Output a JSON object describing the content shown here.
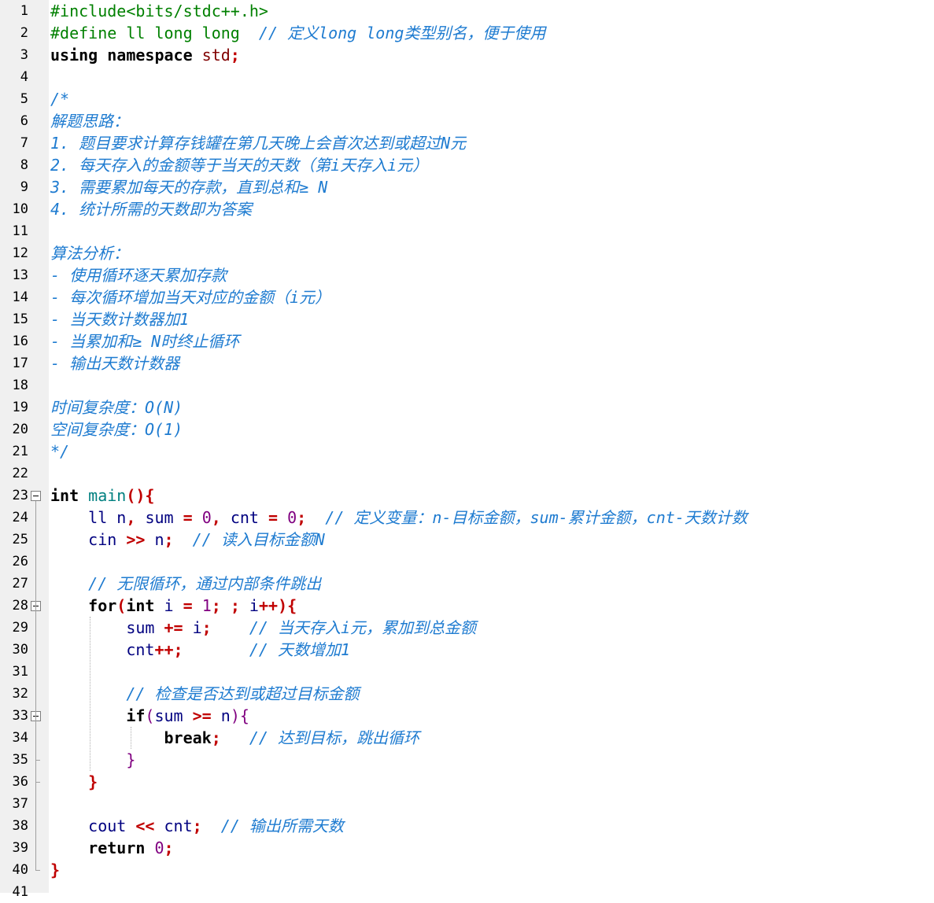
{
  "editor": {
    "lines": [
      [
        {
          "c": "pp",
          "t": "#include<bits/stdc++.h>"
        }
      ],
      [
        {
          "c": "pp",
          "t": "#define ll long long  "
        },
        {
          "c": "cm",
          "t": "// 定义long long类型别名，便于使用"
        }
      ],
      [
        {
          "c": "ns",
          "t": "using namespace "
        },
        {
          "c": "std",
          "t": "std"
        },
        {
          "c": "op",
          "t": ";"
        }
      ],
      [],
      [
        {
          "c": "cm",
          "t": "/*"
        }
      ],
      [
        {
          "c": "cm",
          "t": "解题思路："
        }
      ],
      [
        {
          "c": "cm",
          "t": "1. 题目要求计算存钱罐在第几天晚上会首次达到或超过N元"
        }
      ],
      [
        {
          "c": "cm",
          "t": "2. 每天存入的金额等于当天的天数（第i天存入i元）"
        }
      ],
      [
        {
          "c": "cm",
          "t": "3. 需要累加每天的存款，直到总和≥ N"
        }
      ],
      [
        {
          "c": "cm",
          "t": "4. 统计所需的天数即为答案"
        }
      ],
      [],
      [
        {
          "c": "cm",
          "t": "算法分析："
        }
      ],
      [
        {
          "c": "cm",
          "t": "- 使用循环逐天累加存款"
        }
      ],
      [
        {
          "c": "cm",
          "t": "- 每次循环增加当天对应的金额（i元）"
        }
      ],
      [
        {
          "c": "cm",
          "t": "- 当天数计数器加1"
        }
      ],
      [
        {
          "c": "cm",
          "t": "- 当累加和≥ N时终止循环"
        }
      ],
      [
        {
          "c": "cm",
          "t": "- 输出天数计数器"
        }
      ],
      [],
      [
        {
          "c": "cm",
          "t": "时间复杂度：O(N)"
        }
      ],
      [
        {
          "c": "cm",
          "t": "空间复杂度：O(1)"
        }
      ],
      [
        {
          "c": "cm",
          "t": "*/"
        }
      ],
      [],
      [
        {
          "c": "ty",
          "t": "int "
        },
        {
          "c": "fn",
          "t": "main"
        },
        {
          "c": "br1",
          "t": "(){"
        }
      ],
      [
        {
          "c": "plain",
          "t": "    "
        },
        {
          "c": "id",
          "t": "ll n"
        },
        {
          "c": "op",
          "t": ", "
        },
        {
          "c": "id",
          "t": "sum "
        },
        {
          "c": "op",
          "t": "= "
        },
        {
          "c": "num",
          "t": "0"
        },
        {
          "c": "op",
          "t": ", "
        },
        {
          "c": "id",
          "t": "cnt "
        },
        {
          "c": "op",
          "t": "= "
        },
        {
          "c": "num",
          "t": "0"
        },
        {
          "c": "op",
          "t": ";  "
        },
        {
          "c": "cm",
          "t": "// 定义变量：n-目标金额，sum-累计金额，cnt-天数计数"
        }
      ],
      [
        {
          "c": "plain",
          "t": "    "
        },
        {
          "c": "id",
          "t": "cin "
        },
        {
          "c": "op",
          "t": ">> "
        },
        {
          "c": "id",
          "t": "n"
        },
        {
          "c": "op",
          "t": ";  "
        },
        {
          "c": "cm",
          "t": "// 读入目标金额N"
        }
      ],
      [],
      [
        {
          "c": "plain",
          "t": "    "
        },
        {
          "c": "cm",
          "t": "// 无限循环，通过内部条件跳出"
        }
      ],
      [
        {
          "c": "plain",
          "t": "    "
        },
        {
          "c": "kw",
          "t": "for"
        },
        {
          "c": "br1",
          "t": "("
        },
        {
          "c": "ty",
          "t": "int "
        },
        {
          "c": "id",
          "t": "i "
        },
        {
          "c": "op",
          "t": "= "
        },
        {
          "c": "num",
          "t": "1"
        },
        {
          "c": "op",
          "t": "; ; "
        },
        {
          "c": "id",
          "t": "i"
        },
        {
          "c": "op",
          "t": "++"
        },
        {
          "c": "br1",
          "t": "){"
        }
      ],
      [
        {
          "c": "plain",
          "t": "        "
        },
        {
          "c": "id",
          "t": "sum "
        },
        {
          "c": "op",
          "t": "+= "
        },
        {
          "c": "id",
          "t": "i"
        },
        {
          "c": "op",
          "t": ";    "
        },
        {
          "c": "cm",
          "t": "// 当天存入i元，累加到总金额"
        }
      ],
      [
        {
          "c": "plain",
          "t": "        "
        },
        {
          "c": "id",
          "t": "cnt"
        },
        {
          "c": "op",
          "t": "++;       "
        },
        {
          "c": "cm",
          "t": "// 天数增加1"
        }
      ],
      [],
      [
        {
          "c": "plain",
          "t": "        "
        },
        {
          "c": "cm",
          "t": "// 检查是否达到或超过目标金额"
        }
      ],
      [
        {
          "c": "plain",
          "t": "        "
        },
        {
          "c": "kw",
          "t": "if"
        },
        {
          "c": "br2",
          "t": "("
        },
        {
          "c": "id",
          "t": "sum "
        },
        {
          "c": "op",
          "t": ">= "
        },
        {
          "c": "id",
          "t": "n"
        },
        {
          "c": "br2",
          "t": "){"
        }
      ],
      [
        {
          "c": "plain",
          "t": "            "
        },
        {
          "c": "kw",
          "t": "break"
        },
        {
          "c": "op",
          "t": ";   "
        },
        {
          "c": "cm",
          "t": "// 达到目标，跳出循环"
        }
      ],
      [
        {
          "c": "plain",
          "t": "        "
        },
        {
          "c": "br2",
          "t": "}"
        }
      ],
      [
        {
          "c": "plain",
          "t": "    "
        },
        {
          "c": "br1",
          "t": "}"
        }
      ],
      [],
      [
        {
          "c": "plain",
          "t": "    "
        },
        {
          "c": "id",
          "t": "cout "
        },
        {
          "c": "op",
          "t": "<< "
        },
        {
          "c": "id",
          "t": "cnt"
        },
        {
          "c": "op",
          "t": ";  "
        },
        {
          "c": "cm",
          "t": "// 输出所需天数"
        }
      ],
      [
        {
          "c": "plain",
          "t": "    "
        },
        {
          "c": "kw",
          "t": "return "
        },
        {
          "c": "num",
          "t": "0"
        },
        {
          "c": "op",
          "t": ";"
        }
      ],
      [
        {
          "c": "br1",
          "t": "}"
        }
      ],
      []
    ],
    "line_numbers": [
      "1",
      "2",
      "3",
      "4",
      "5",
      "6",
      "7",
      "8",
      "9",
      "10",
      "11",
      "12",
      "13",
      "14",
      "15",
      "16",
      "17",
      "18",
      "19",
      "20",
      "21",
      "22",
      "23",
      "24",
      "25",
      "26",
      "27",
      "28",
      "29",
      "30",
      "31",
      "32",
      "33",
      "34",
      "35",
      "36",
      "37",
      "38",
      "39",
      "40",
      "41"
    ],
    "fold_markers": [
      23,
      28,
      33
    ]
  }
}
